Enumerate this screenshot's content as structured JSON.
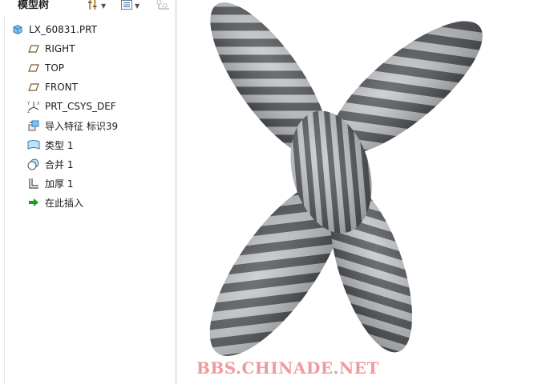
{
  "model_tree": {
    "title": "模型树",
    "items": [
      {
        "label": "LX_60831.PRT",
        "icon": "part-icon"
      },
      {
        "label": "RIGHT",
        "icon": "datum-plane-icon"
      },
      {
        "label": "TOP",
        "icon": "datum-plane-icon"
      },
      {
        "label": "FRONT",
        "icon": "datum-plane-icon"
      },
      {
        "label": "PRT_CSYS_DEF",
        "icon": "coordinate-system-icon"
      },
      {
        "label": "导入特征 标识39",
        "icon": "import-feature-icon"
      },
      {
        "label": "类型 1",
        "icon": "surface-type-icon"
      },
      {
        "label": "合并 1",
        "icon": "merge-icon"
      },
      {
        "label": "加厚 1",
        "icon": "thicken-icon"
      },
      {
        "label": "在此插入",
        "icon": "insert-here-arrow-icon"
      }
    ]
  },
  "toolbar": {
    "icons": [
      "settings-icon",
      "show-icon",
      "filter-icon"
    ]
  },
  "viewport": {
    "watermark": "BBS.CHINADE.NET",
    "model_colors": {
      "dark": "#505357",
      "light": "#c4c7cb"
    }
  },
  "colors": {
    "datum": "#7a5a2a",
    "part": "#4a9fd8",
    "insert_arrow": "#1e9a1e",
    "watermark": "#f09a9a"
  }
}
